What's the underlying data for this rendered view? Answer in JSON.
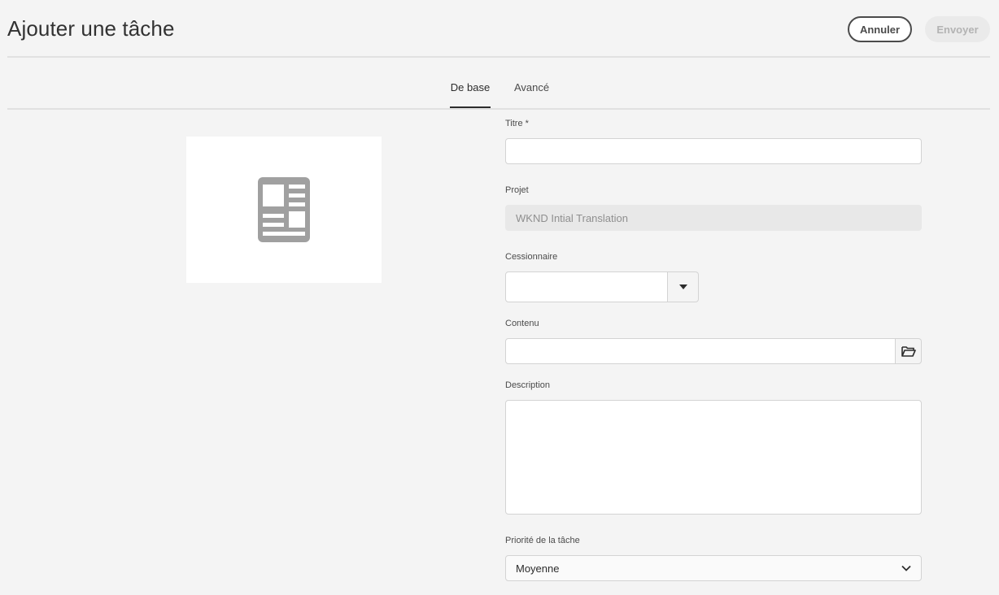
{
  "header": {
    "title": "Ajouter une tâche",
    "cancel_label": "Annuler",
    "send_label": "Envoyer"
  },
  "tabs": [
    {
      "label": "De base",
      "active": true
    },
    {
      "label": "Avancé",
      "active": false
    }
  ],
  "thumbnail": {
    "icon": "document-icon"
  },
  "form": {
    "title_label": "Titre *",
    "title_value": "",
    "project_label": "Projet",
    "project_value": "WKND Intial Translation",
    "assignee_label": "Cessionnaire",
    "assignee_value": "",
    "content_label": "Contenu",
    "content_value": "",
    "description_label": "Description",
    "description_value": "",
    "priority_label": "Priorité de la tâche",
    "priority_value": "Moyenne"
  },
  "colors": {
    "background": "#f4f4f4",
    "thumbnail_icon": "#a0a0a0",
    "disabled_button": "#eaeaea"
  }
}
